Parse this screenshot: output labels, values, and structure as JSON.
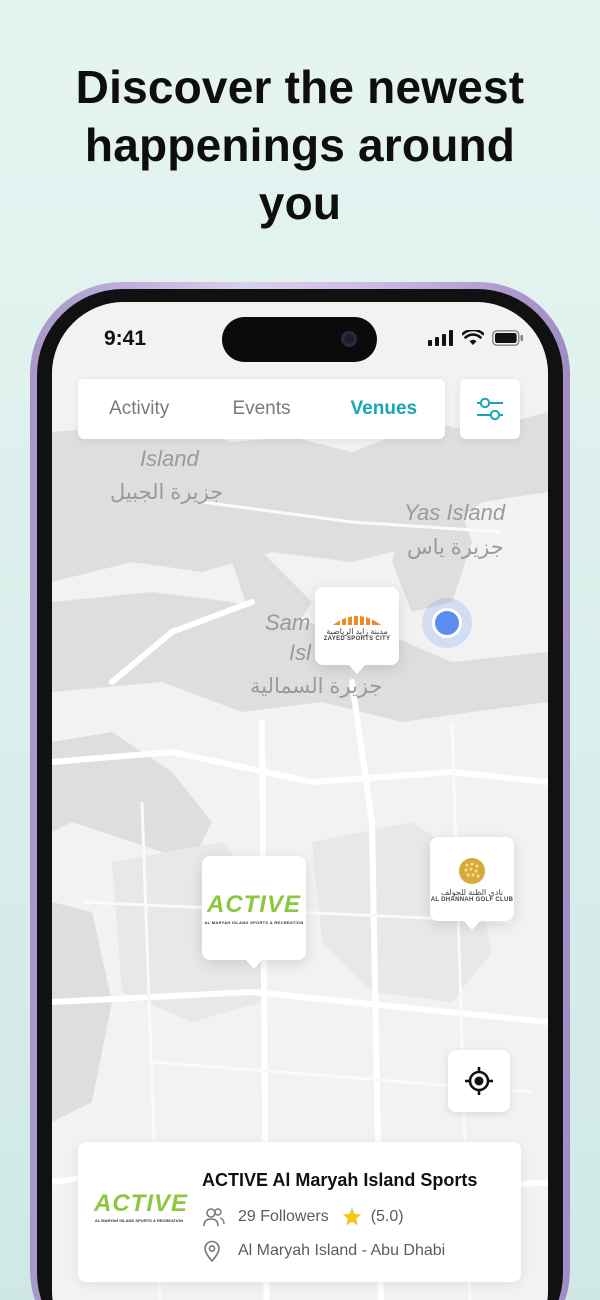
{
  "headline": {
    "line1": "Discover the newest",
    "line2": "happenings around",
    "line3": "you"
  },
  "status_bar": {
    "time": "9:41"
  },
  "tabs": [
    {
      "label": "Activity",
      "active": false
    },
    {
      "label": "Events",
      "active": false
    },
    {
      "label": "Venues",
      "active": true
    }
  ],
  "map": {
    "labels": {
      "island": "Island",
      "jubail_ar": "جزيرة الجبيل",
      "yas": "Yas Island",
      "yas_ar": "جزيرة ياس",
      "saadiyat_partial1": "Sam",
      "saadiyat_partial2": "Isl",
      "samaliya_ar": "جزيرة السمالية"
    },
    "markers": {
      "zayed": {
        "ar": "مدينة زايد الرياضية",
        "en": "ZAYED SPORTS CITY"
      },
      "active": {
        "logo": "ACTIVE",
        "sub": "AL MARYAH ISLAND SPORTS & RECREATION"
      },
      "dhannah": {
        "ar": "نادي الظنة للجولف",
        "en": "AL DHANNAH GOLF CLUB"
      }
    }
  },
  "venue_card": {
    "logo": "ACTIVE",
    "logo_sub": "AL MARYAH ISLAND SPORTS & RECREATION",
    "name": "ACTIVE Al Maryah Island Sports",
    "followers": "29 Followers",
    "rating": "(5.0)",
    "location": "Al Maryah Island - Abu Dhabi"
  },
  "colors": {
    "accent": "#17a6b4",
    "star": "#f5c518",
    "location_dot": "#5b8def",
    "active_green": "#8dc63f"
  }
}
